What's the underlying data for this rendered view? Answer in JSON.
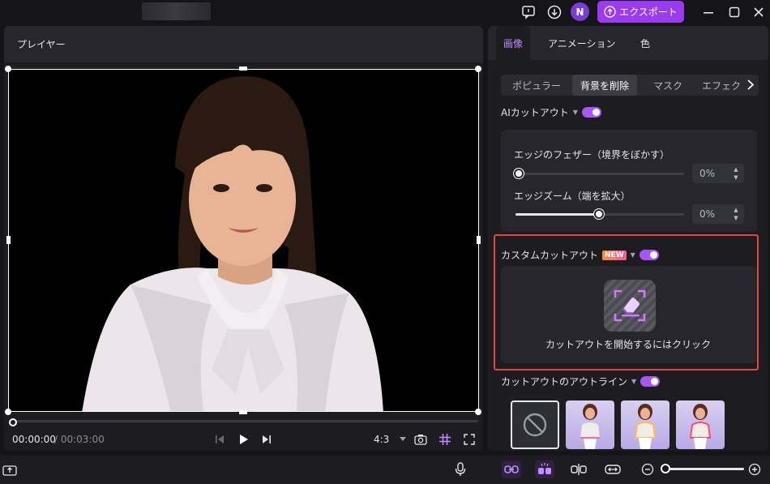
{
  "titlebar": {
    "avatar_letter": "N",
    "export_label": "エクスポート"
  },
  "player": {
    "title": "プレイヤー",
    "time_current": "00:00:00",
    "time_total": "/ 00:03:00",
    "aspect_ratio": "4:3",
    "progress": 0
  },
  "panel": {
    "tabs": [
      "画像",
      "アニメーション",
      "色"
    ],
    "active_tab": "画像",
    "subtabs": [
      "ポピュラー",
      "背景を削除",
      "マスク",
      "エフェク"
    ],
    "active_subtab": "背景を削除",
    "ai_cutout": {
      "label": "AIカットアウト",
      "enabled": true,
      "edge_feather_label": "エッジのフェザー（境界をぼかす）",
      "edge_feather_value": "0%",
      "edge_feather_level": 0,
      "edge_zoom_label": "エッジズーム（端を拡大）",
      "edge_zoom_value": "0%",
      "edge_zoom_level": 0.5
    },
    "custom_cutout": {
      "label": "カスタムカットアウト",
      "badge": "NEW",
      "enabled": true,
      "action_label": "カットアウトを開始するにはクリック"
    },
    "outline": {
      "label": "カットアウトのアウトライン",
      "enabled": true
    }
  },
  "colors": {
    "accent": "#a855f7",
    "export_bg": "#9b3bf0",
    "highlight": "#e2493d",
    "background": "#151519",
    "panel": "#1c1c21"
  }
}
